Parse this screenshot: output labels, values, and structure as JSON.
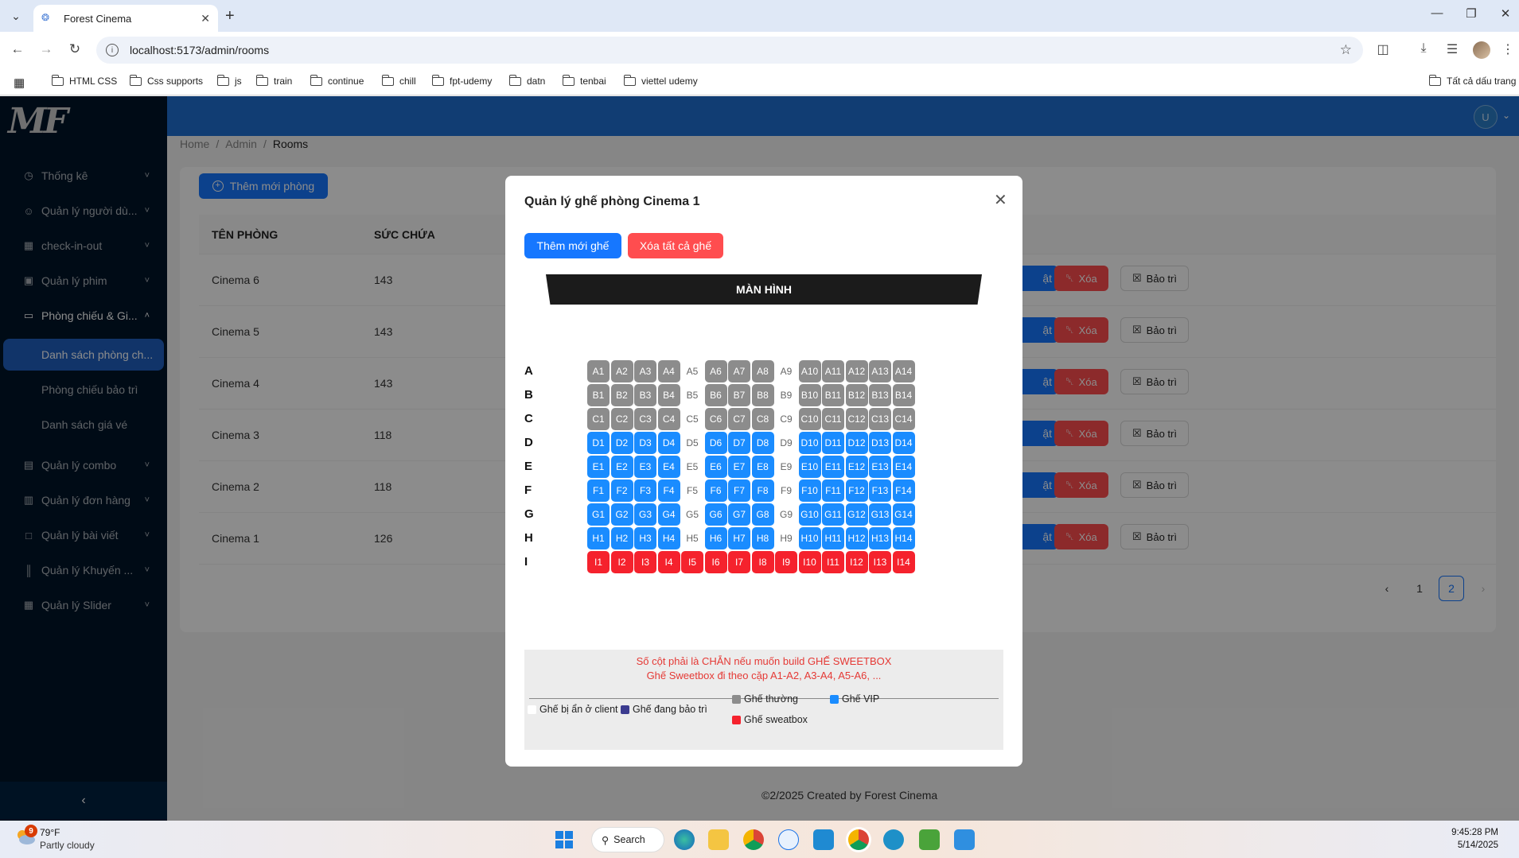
{
  "browser": {
    "tab_title": "Forest Cinema",
    "url": "localhost:5173/admin/rooms",
    "bookmarks": [
      "HTML CSS",
      "Css supports",
      "js",
      "train",
      "continue",
      "chill",
      "fpt-udemy",
      "datn",
      "tenbai",
      "viettel udemy"
    ],
    "all_bookmarks": "Tất cả dấu trang"
  },
  "sidebar": {
    "items": [
      {
        "label": "Thống kê",
        "icon": "dashboard-icon"
      },
      {
        "label": "Quản lý người dù...",
        "icon": "user-icon"
      },
      {
        "label": "check-in-out",
        "icon": "calendar-icon"
      },
      {
        "label": "Quản lý phim",
        "icon": "film-icon"
      },
      {
        "label": "Phòng chiếu & Gi...",
        "icon": "desktop-icon"
      },
      {
        "label": "Quản lý combo",
        "icon": "shopping-icon"
      },
      {
        "label": "Quản lý đơn hàng",
        "icon": "bag-icon"
      },
      {
        "label": "Quản lý bài viết",
        "icon": "file-icon"
      },
      {
        "label": "Quản lý Khuyến ...",
        "icon": "barcode-icon"
      },
      {
        "label": "Quản lý Slider",
        "icon": "appstore-icon"
      }
    ],
    "subitems": [
      "Danh sách phòng ch...",
      "Phòng chiếu bảo trì",
      "Danh sách giá vé"
    ]
  },
  "header": {
    "avatar_letter": "U"
  },
  "breadcrumb": {
    "home": "Home",
    "admin": "Admin",
    "current": "Rooms"
  },
  "page": {
    "add_button": "Thêm mới phòng",
    "columns": {
      "name": "TÊN PHÒNG",
      "capacity": "SỨC CHỨA"
    },
    "rows": [
      {
        "name": "Cinema 6",
        "capacity": "143"
      },
      {
        "name": "Cinema 5",
        "capacity": "143"
      },
      {
        "name": "Cinema 4",
        "capacity": "143"
      },
      {
        "name": "Cinema 3",
        "capacity": "118"
      },
      {
        "name": "Cinema 2",
        "capacity": "118"
      },
      {
        "name": "Cinema 1",
        "capacity": "126"
      }
    ],
    "edit_label": "ật",
    "delete_label": "Xóa",
    "maintenance_label": "Bảo trì",
    "pages": [
      "1",
      "2"
    ],
    "current_page": "2",
    "footer": "©2/2025 Created by Forest Cinema"
  },
  "modal": {
    "title": "Quản lý ghế phòng Cinema 1",
    "add_seat": "Thêm mới ghế",
    "delete_all": "Xóa tất cả ghế",
    "screen": "MÀN HÌNH",
    "seat_rows": [
      {
        "row": "A",
        "type": "regular"
      },
      {
        "row": "B",
        "type": "regular"
      },
      {
        "row": "C",
        "type": "regular"
      },
      {
        "row": "D",
        "type": "vip"
      },
      {
        "row": "E",
        "type": "vip"
      },
      {
        "row": "F",
        "type": "vip"
      },
      {
        "row": "G",
        "type": "vip"
      },
      {
        "row": "H",
        "type": "vip"
      },
      {
        "row": "I",
        "type": "sweetbox"
      }
    ],
    "columns": 14,
    "hidden_columns": [
      5,
      9
    ],
    "hidden_columns_sweetbox": [],
    "note_line1": "Số cột phải là CHẴN nếu muốn build GHẾ SWEETBOX",
    "note_line2": "Ghế Sweetbox đi theo cặp A1-A2, A3-A4, A5-A6, ...",
    "legend": {
      "hidden": "Ghế bị ẩn ở client",
      "maintenance": "Ghế đang bảo trì",
      "regular": "Ghế thường",
      "vip": "Ghế VIP",
      "sweetbox": "Ghế sweatbox"
    },
    "colors": {
      "regular": "#8c8c8c",
      "vip": "#1a8cff",
      "sweetbox": "#f5222d",
      "maintenance": "#3b3b8f",
      "hidden": "#ffffff"
    }
  },
  "taskbar": {
    "weather_badge": "9",
    "temp": "79°F",
    "weather": "Partly cloudy",
    "search": "Search",
    "time": "9:45:28 PM",
    "date": "5/14/2025"
  }
}
